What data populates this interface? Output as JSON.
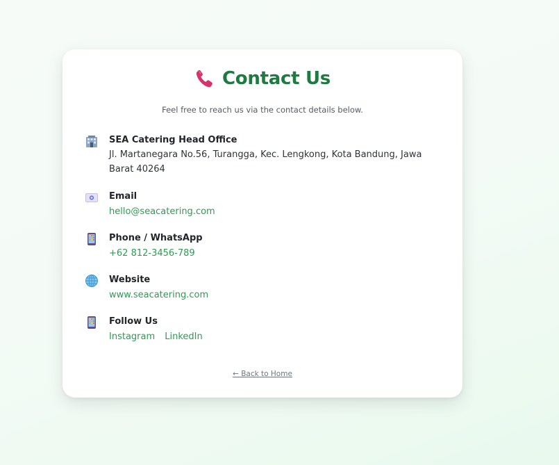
{
  "header": {
    "icon": "telephone-receiver-icon",
    "title": "Contact Us",
    "subtitle": "Feel free to reach us via the contact details below."
  },
  "office": {
    "icon": "office-building-icon",
    "label": "SEA Catering Head Office",
    "address_line1": "Jl. Martanegara No.56, Turangga, Kec. Lengkong, Kota Bandung, Jawa",
    "address_line2": "Barat 40264"
  },
  "email": {
    "icon": "envelope-icon",
    "label": "Email",
    "value": "hello@seacatering.com"
  },
  "phone": {
    "icon": "mobile-phone-icon",
    "label": "Phone / WhatsApp",
    "value": "+62 812-3456-789"
  },
  "website": {
    "icon": "globe-icon",
    "label": "Website",
    "value": "www.seacatering.com"
  },
  "social": {
    "icon": "mobile-phone-icon",
    "label": "Follow Us",
    "links": [
      "Instagram",
      "LinkedIn"
    ]
  },
  "footer": {
    "back_label": "← Back to Home"
  },
  "colors": {
    "title_green": "#1e7a40",
    "link_green": "#2f9a55",
    "phone_icon_pink": "#d6336c"
  }
}
